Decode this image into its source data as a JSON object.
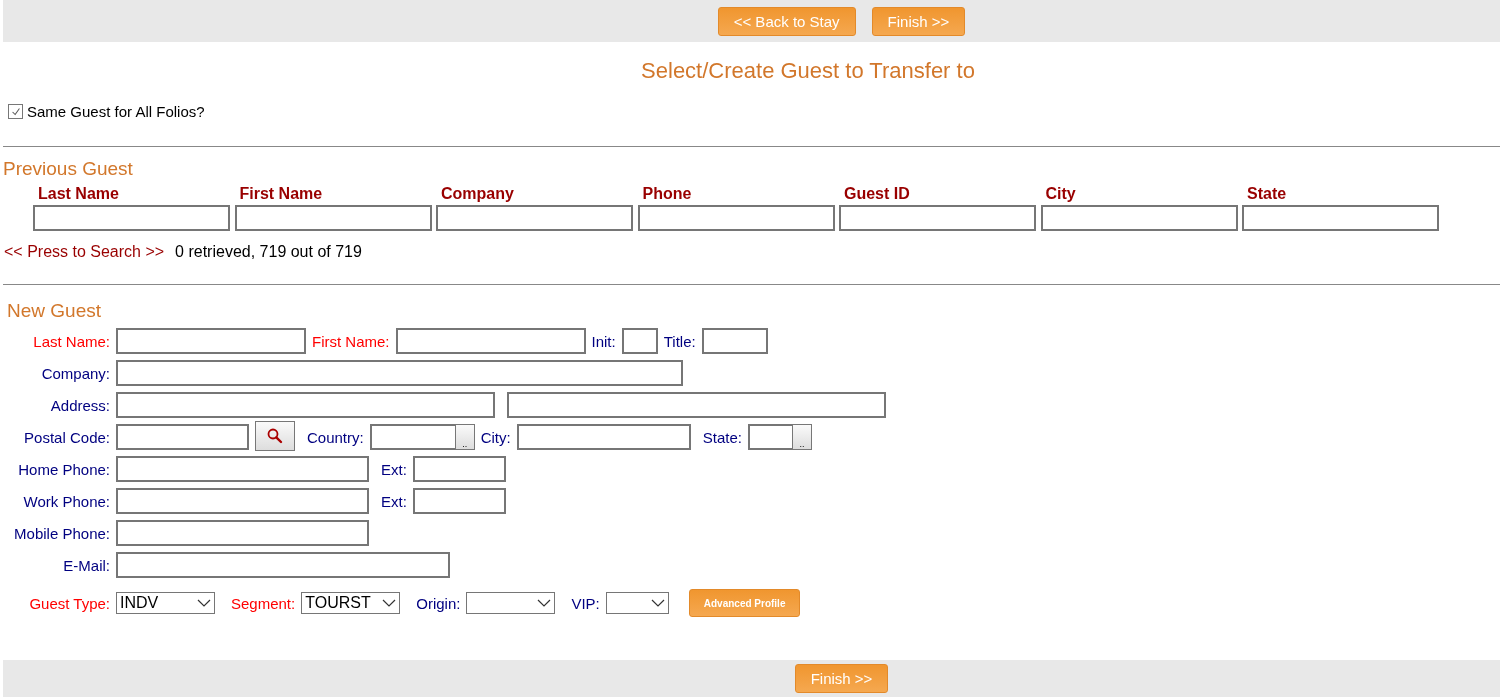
{
  "top_bar": {
    "buttons": [
      "<< Back to Stay",
      "Finish >>"
    ]
  },
  "title": "Select/Create Guest to Transfer to",
  "same_guest": {
    "label": "Same Guest for All Folios?",
    "checked": true
  },
  "previous_guest": {
    "heading": "Previous Guest",
    "columns": [
      "Last Name",
      "First Name",
      "Company",
      "Phone",
      "Guest ID",
      "City",
      "State"
    ],
    "search_link": "<< Press to Search >>",
    "result_text": "0 retrieved, 719 out of 719"
  },
  "new_guest": {
    "heading": "New Guest",
    "lines": [
      {
        "fields": [
          {
            "label": "Last Name:",
            "required": true,
            "kind": "text"
          },
          {
            "label": "First Name:",
            "required": true,
            "kind": "text"
          },
          {
            "label": "Init:",
            "required": false,
            "kind": "text"
          },
          {
            "label": "Title:",
            "required": false,
            "kind": "text"
          }
        ]
      },
      {
        "fields": [
          {
            "label": "Company:",
            "required": false,
            "kind": "text"
          }
        ]
      },
      {
        "fields": [
          {
            "label": "Address:",
            "required": false,
            "kind": "text"
          },
          {
            "kind": "text"
          }
        ]
      },
      {
        "fields": [
          {
            "label": "Postal Code:",
            "required": false,
            "kind": "search"
          },
          {
            "label": "Country:",
            "required": false,
            "kind": "lookup",
            "button": ".."
          },
          {
            "label": "City:",
            "required": false,
            "kind": "text"
          },
          {
            "label": "State:",
            "required": false,
            "kind": "lookup",
            "button": ".."
          }
        ]
      },
      {
        "fields": [
          {
            "label": "Home Phone:",
            "required": false,
            "kind": "text"
          },
          {
            "label": "Ext:",
            "required": false,
            "kind": "text"
          }
        ]
      },
      {
        "fields": [
          {
            "label": "Work Phone:",
            "required": false,
            "kind": "text"
          },
          {
            "label": "Ext:",
            "required": false,
            "kind": "text"
          }
        ]
      },
      {
        "fields": [
          {
            "label": "Mobile Phone:",
            "required": false,
            "kind": "text"
          }
        ]
      },
      {
        "fields": [
          {
            "label": "E-Mail:",
            "required": false,
            "kind": "text"
          }
        ]
      },
      {
        "fields": [
          {
            "label": "Guest Type:",
            "required": true,
            "kind": "select",
            "value": "INDV"
          },
          {
            "label": "Segment:",
            "required": true,
            "kind": "select",
            "value": "TOURST"
          },
          {
            "label": "Origin:",
            "required": false,
            "kind": "select"
          },
          {
            "label": "VIP:",
            "required": false,
            "kind": "select"
          },
          {
            "kind": "button",
            "text": "Advanced Profile"
          }
        ]
      }
    ]
  },
  "bottom_bar": {
    "buttons": [
      "Finish >>"
    ]
  }
}
